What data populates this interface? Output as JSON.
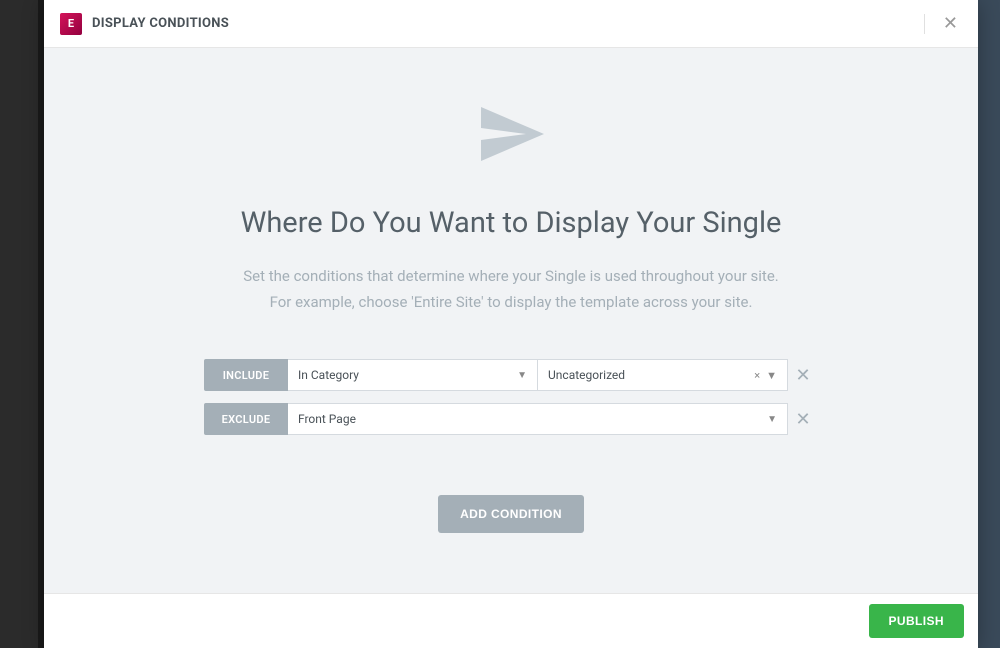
{
  "header": {
    "logo_text": "E",
    "title": "DISPLAY CONDITIONS"
  },
  "body": {
    "heading": "Where Do You Want to Display Your Single",
    "subtext_line1": "Set the conditions that determine where your Single is used throughout your site.",
    "subtext_line2": "For example, choose 'Entire Site' to display the template across your site."
  },
  "conditions": [
    {
      "type": "INCLUDE",
      "primary": "In Category",
      "secondary": "Uncategorized"
    },
    {
      "type": "EXCLUDE",
      "primary": "Front Page",
      "secondary": null
    }
  ],
  "buttons": {
    "add": "ADD CONDITION",
    "publish": "PUBLISH"
  }
}
